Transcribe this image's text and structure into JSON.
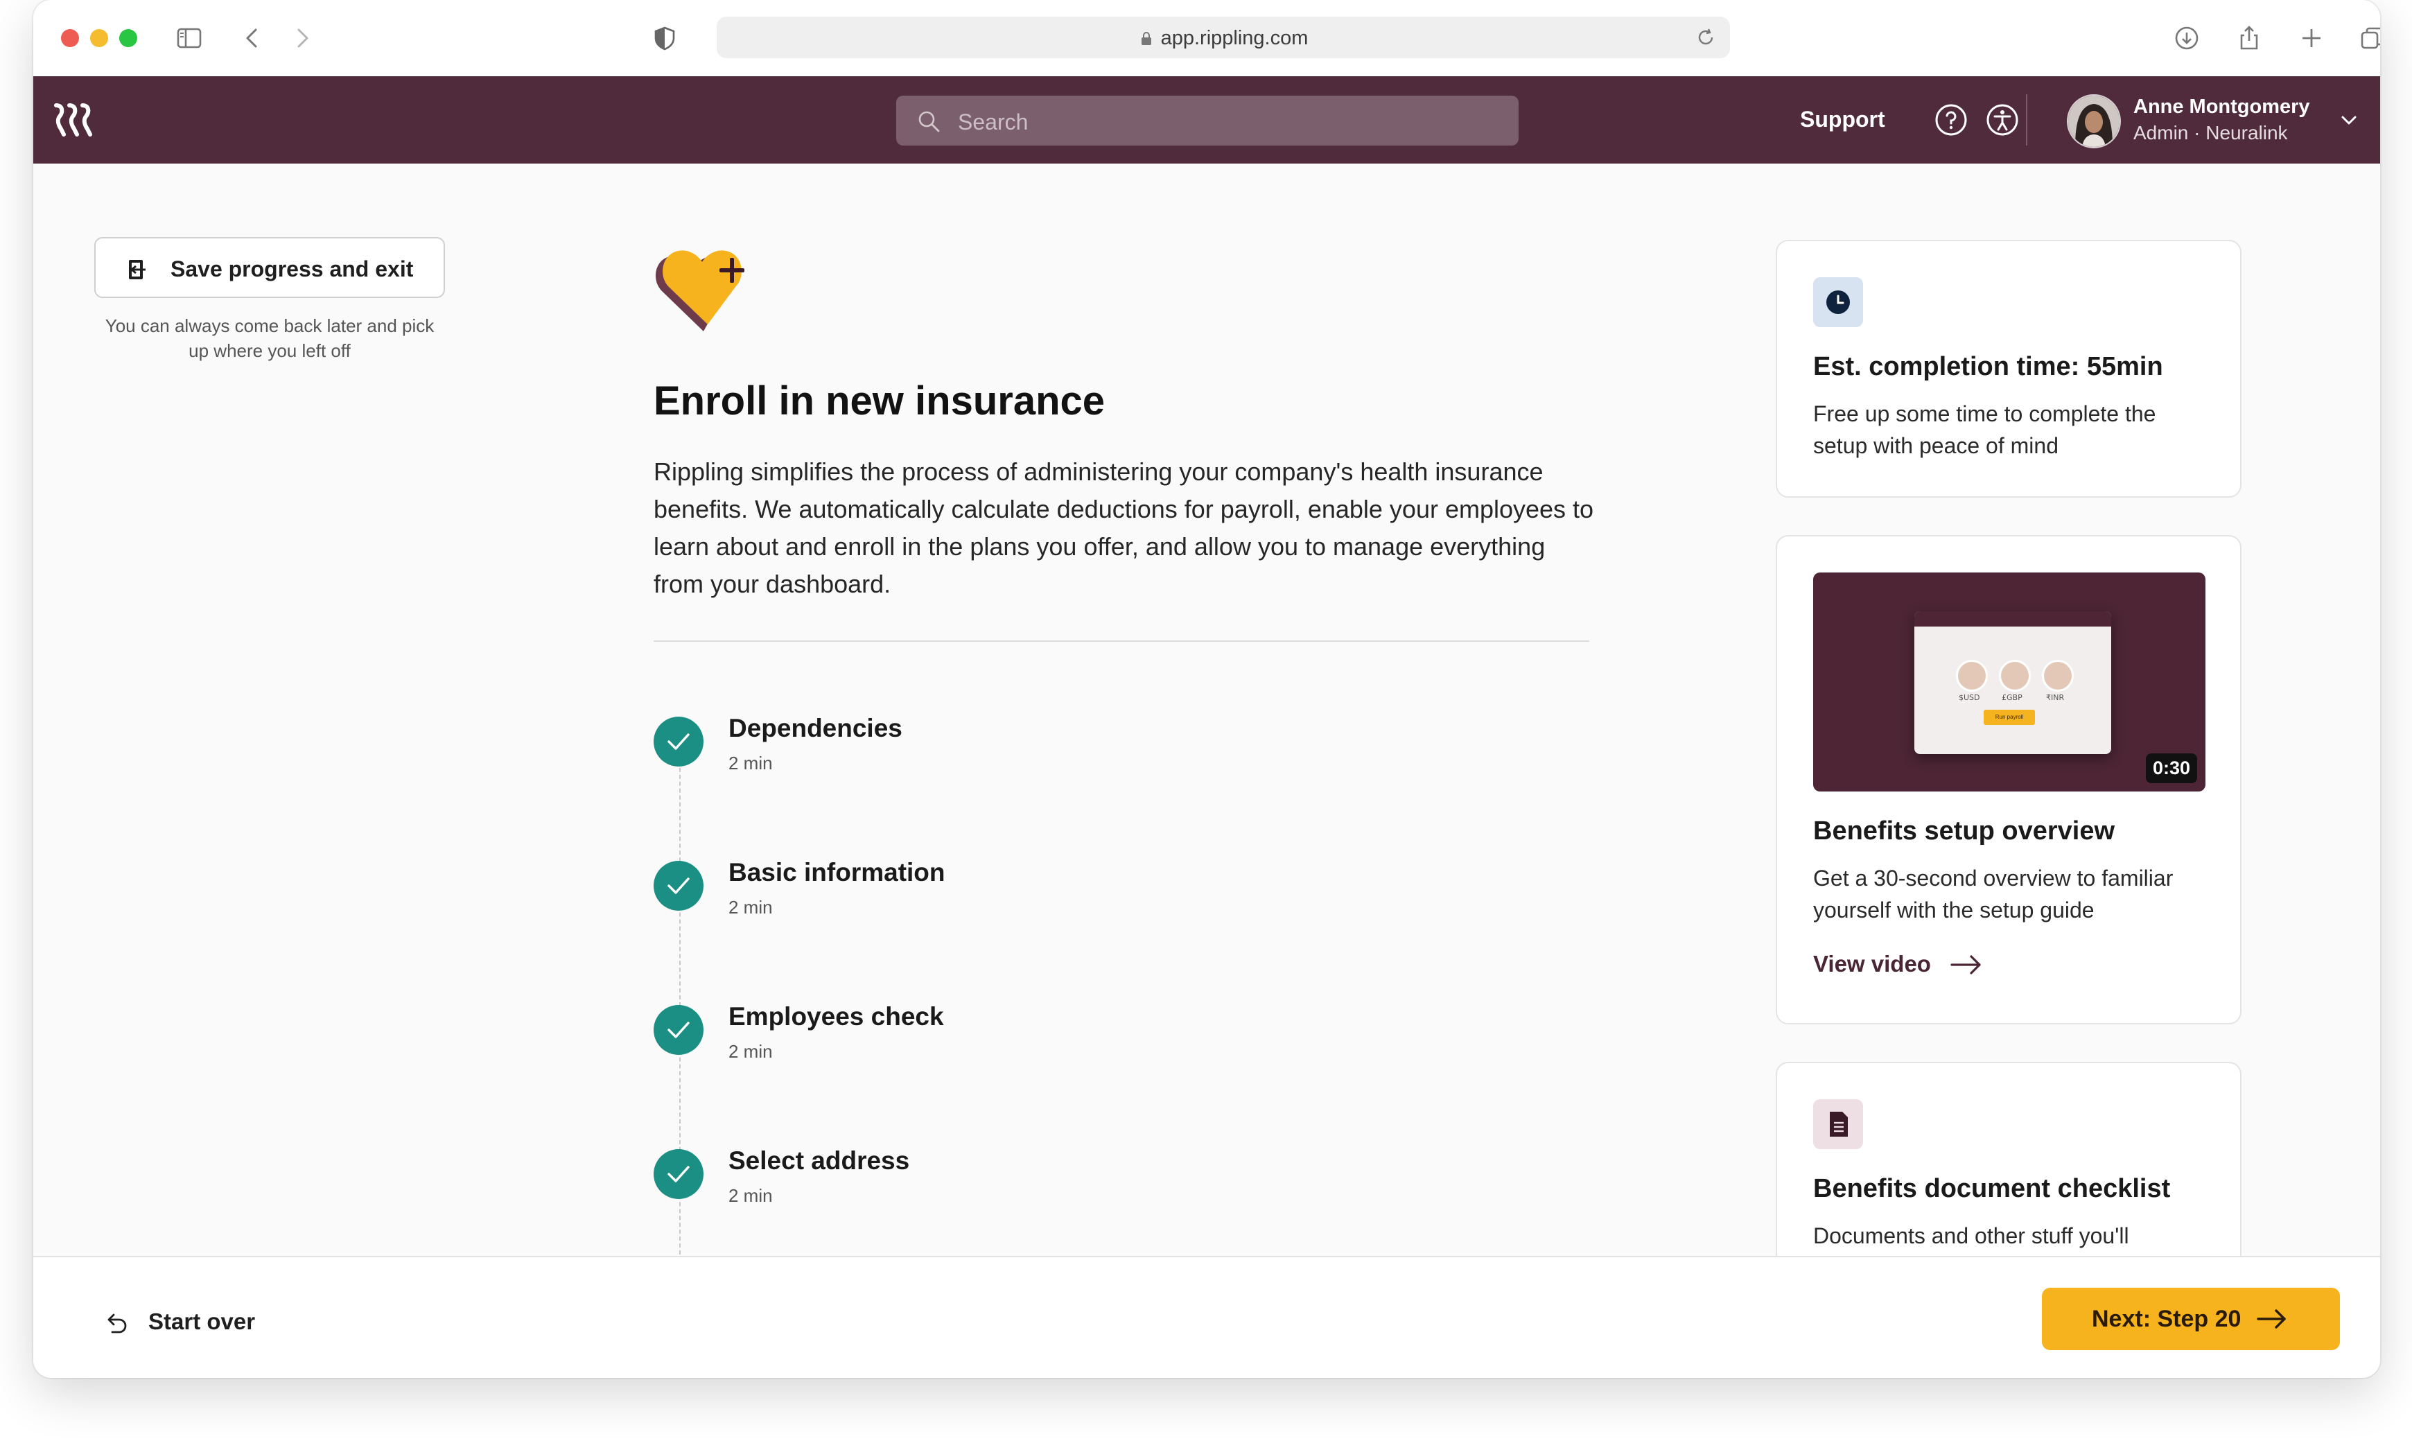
{
  "browser": {
    "url": "app.rippling.com",
    "icons": [
      "sidebar-icon",
      "back-icon",
      "forward-icon",
      "privacy-shield-icon",
      "lock-icon",
      "reload-icon",
      "download-icon",
      "share-icon",
      "new-tab-icon",
      "tabs-overview-icon"
    ]
  },
  "header": {
    "logo": "rippling-logo",
    "search_placeholder": "Search",
    "support_label": "Support",
    "user": {
      "name": "Anne Montgomery",
      "role": "Admin · Neuralink"
    }
  },
  "left": {
    "save_label": "Save progress and exit",
    "save_hint": "You can always come back later and pick up where you left off"
  },
  "main": {
    "title": "Enroll in new insurance",
    "description": "Rippling simplifies the process of administering your company's health insurance benefits. We automatically calculate deductions for payroll, enable your employees to learn about and enroll in the plans you offer, and allow you to manage everything from your dashboard.",
    "steps": [
      {
        "title": "Dependencies",
        "duration": "2 min",
        "done": true
      },
      {
        "title": "Basic information",
        "duration": "2 min",
        "done": true
      },
      {
        "title": "Employees check",
        "duration": "2 min",
        "done": true
      },
      {
        "title": "Select address",
        "duration": "2 min",
        "done": true
      }
    ]
  },
  "cards": {
    "completion": {
      "title": "Est. completion time: 55min",
      "desc": "Free up some time to complete the setup with peace of mind"
    },
    "video": {
      "duration": "0:30",
      "thumb_labels": [
        "$USD",
        "£GBP",
        "₹INR"
      ],
      "thumb_button": "Run payroll",
      "title": "Benefits setup overview",
      "desc": "Get a 30-second overview to familiar yourself with the setup guide",
      "link": "View video"
    },
    "checklist": {
      "title": "Benefits document checklist",
      "desc": "Documents and other stuff you'll"
    }
  },
  "footer": {
    "start_over": "Start over",
    "next": "Next: Step 20"
  },
  "colors": {
    "brand": "#502b3b",
    "accent": "#f6b31d",
    "success": "#1b8f83"
  }
}
